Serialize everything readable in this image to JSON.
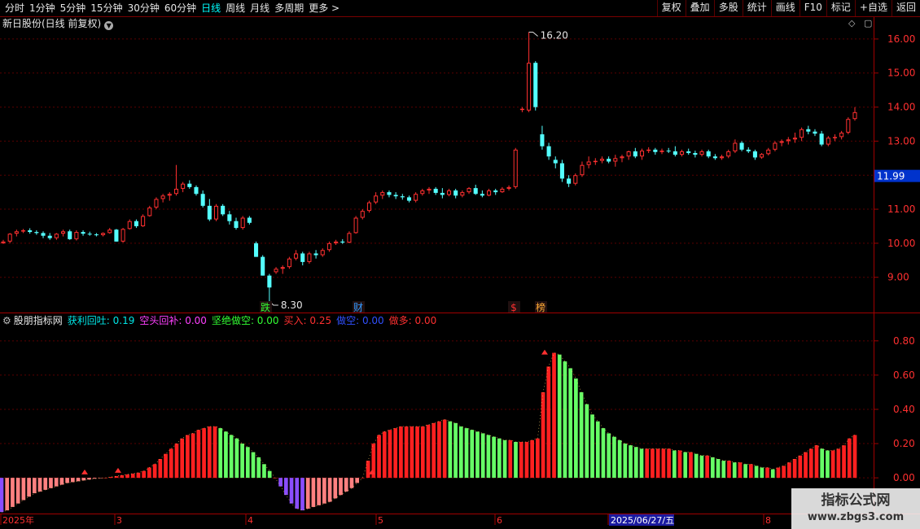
{
  "toolbar": {
    "tabs": [
      "分时",
      "1分钟",
      "5分钟",
      "15分钟",
      "30分钟",
      "60分钟",
      "日线",
      "周线",
      "月线",
      "多周期",
      "更多 >"
    ],
    "active_tab": "日线",
    "tools": [
      "复权",
      "叠加",
      "多股",
      "统计",
      "画线",
      "F10",
      "标记",
      "+自选",
      "返回"
    ]
  },
  "chart_title": "新日股份(日线 前复权)",
  "current_price_label": "11.99",
  "indicator": {
    "name": "股朋指标网",
    "items": [
      {
        "label": "获利回吐: 0.19",
        "color": "#00e5e5"
      },
      {
        "label": "空头回补: 0.00",
        "color": "#ff40ff"
      },
      {
        "label": "坚绝做空: 0.00",
        "color": "#33ff33"
      },
      {
        "label": "买入: 0.25",
        "color": "#ff3030"
      },
      {
        "label": "做空: 0.00",
        "color": "#3050ff"
      },
      {
        "label": "做多: 0.00",
        "color": "#ff3030"
      }
    ]
  },
  "watermark": {
    "line1": "指标公式网",
    "line2": "www.zbgs3.com"
  },
  "chart_data": [
    {
      "type": "candlestick",
      "ylim": [
        8.3,
        16.5
      ],
      "yticks": [
        9.0,
        10.0,
        11.0,
        12.0,
        13.0,
        14.0,
        15.0,
        16.0
      ],
      "high_label": "16.20",
      "low_label": "8.30",
      "markers": [
        "跌",
        "财",
        "$",
        "榜"
      ],
      "candles": [
        [
          10.0,
          10.1,
          9.98,
          10.05
        ],
        [
          10.05,
          10.3,
          10.0,
          10.28
        ],
        [
          10.28,
          10.4,
          10.2,
          10.35
        ],
        [
          10.35,
          10.42,
          10.3,
          10.38
        ],
        [
          10.38,
          10.44,
          10.28,
          10.33
        ],
        [
          10.33,
          10.38,
          10.25,
          10.3
        ],
        [
          10.3,
          10.35,
          10.15,
          10.22
        ],
        [
          10.22,
          10.3,
          10.1,
          10.15
        ],
        [
          10.15,
          10.3,
          10.1,
          10.28
        ],
        [
          10.28,
          10.4,
          10.2,
          10.35
        ],
        [
          10.35,
          10.4,
          10.1,
          10.12
        ],
        [
          10.12,
          10.38,
          10.08,
          10.33
        ],
        [
          10.33,
          10.38,
          10.22,
          10.28
        ],
        [
          10.28,
          10.34,
          10.22,
          10.26
        ],
        [
          10.26,
          10.3,
          10.2,
          10.24
        ],
        [
          10.24,
          10.32,
          10.2,
          10.3
        ],
        [
          10.3,
          10.45,
          10.28,
          10.4
        ],
        [
          10.4,
          10.42,
          10.05,
          10.05
        ],
        [
          10.05,
          10.45,
          10.02,
          10.42
        ],
        [
          10.42,
          10.7,
          10.4,
          10.65
        ],
        [
          10.65,
          10.7,
          10.45,
          10.5
        ],
        [
          10.5,
          10.85,
          10.48,
          10.8
        ],
        [
          10.8,
          11.1,
          10.78,
          11.05
        ],
        [
          11.05,
          11.35,
          11.0,
          11.3
        ],
        [
          11.3,
          11.45,
          11.2,
          11.4
        ],
        [
          11.4,
          11.5,
          11.25,
          11.45
        ],
        [
          11.45,
          12.3,
          11.4,
          11.6
        ],
        [
          11.6,
          11.8,
          11.5,
          11.75
        ],
        [
          11.75,
          11.85,
          11.6,
          11.65
        ],
        [
          11.65,
          11.7,
          11.4,
          11.45
        ],
        [
          11.45,
          11.55,
          11.05,
          11.1
        ],
        [
          11.1,
          11.3,
          10.65,
          10.7
        ],
        [
          10.7,
          11.15,
          10.65,
          11.1
        ],
        [
          11.1,
          11.15,
          10.8,
          10.85
        ],
        [
          10.85,
          10.95,
          10.55,
          10.65
        ],
        [
          10.65,
          10.75,
          10.4,
          10.45
        ],
        [
          10.45,
          10.8,
          10.4,
          10.75
        ],
        [
          10.75,
          10.8,
          10.55,
          10.6
        ],
        [
          10.0,
          10.05,
          9.6,
          9.6
        ],
        [
          9.6,
          9.65,
          9.05,
          9.05
        ],
        [
          9.05,
          9.1,
          8.3,
          8.7
        ],
        [
          9.15,
          9.3,
          9.1,
          9.25
        ],
        [
          9.25,
          9.35,
          9.1,
          9.3
        ],
        [
          9.3,
          9.6,
          9.25,
          9.55
        ],
        [
          9.55,
          9.8,
          9.5,
          9.7
        ],
        [
          9.7,
          9.75,
          9.35,
          9.45
        ],
        [
          9.45,
          9.75,
          9.4,
          9.7
        ],
        [
          9.7,
          9.8,
          9.55,
          9.65
        ],
        [
          9.65,
          9.85,
          9.6,
          9.8
        ],
        [
          9.8,
          10.05,
          9.75,
          10.0
        ],
        [
          10.0,
          10.1,
          9.95,
          10.05
        ],
        [
          10.05,
          10.12,
          9.98,
          10.02
        ],
        [
          10.02,
          10.35,
          10.0,
          10.3
        ],
        [
          10.3,
          10.8,
          10.28,
          10.75
        ],
        [
          10.75,
          11.0,
          10.7,
          10.95
        ],
        [
          10.95,
          11.25,
          10.9,
          11.2
        ],
        [
          11.2,
          11.5,
          11.15,
          11.4
        ],
        [
          11.4,
          11.55,
          11.3,
          11.5
        ],
        [
          11.5,
          11.55,
          11.35,
          11.42
        ],
        [
          11.42,
          11.5,
          11.3,
          11.38
        ],
        [
          11.38,
          11.45,
          11.28,
          11.35
        ],
        [
          11.35,
          11.4,
          11.2,
          11.25
        ],
        [
          11.25,
          11.5,
          11.2,
          11.45
        ],
        [
          11.45,
          11.6,
          11.4,
          11.55
        ],
        [
          11.55,
          11.65,
          11.45,
          11.6
        ],
        [
          11.6,
          11.65,
          11.42,
          11.48
        ],
        [
          11.48,
          11.62,
          11.32,
          11.42
        ],
        [
          11.42,
          11.6,
          11.38,
          11.55
        ],
        [
          11.55,
          11.6,
          11.32,
          11.4
        ],
        [
          11.4,
          11.55,
          11.35,
          11.5
        ],
        [
          11.5,
          11.65,
          11.45,
          11.62
        ],
        [
          11.62,
          11.72,
          11.42,
          11.45
        ],
        [
          11.45,
          11.55,
          11.35,
          11.4
        ],
        [
          11.4,
          11.6,
          11.38,
          11.55
        ],
        [
          11.55,
          11.6,
          11.42,
          11.5
        ],
        [
          11.5,
          11.65,
          11.48,
          11.6
        ],
        [
          11.6,
          11.7,
          11.55,
          11.65
        ],
        [
          11.65,
          12.8,
          11.6,
          12.75
        ],
        [
          13.95,
          14.0,
          13.85,
          13.95
        ],
        [
          13.9,
          16.2,
          13.85,
          15.3
        ],
        [
          15.3,
          15.35,
          13.9,
          14.0
        ],
        [
          13.2,
          13.45,
          12.75,
          12.85
        ],
        [
          12.85,
          12.95,
          12.45,
          12.55
        ],
        [
          12.45,
          12.55,
          12.2,
          12.35
        ],
        [
          12.35,
          12.45,
          11.8,
          11.9
        ],
        [
          11.9,
          12.0,
          11.65,
          11.75
        ],
        [
          11.75,
          12.05,
          11.7,
          12.0
        ],
        [
          12.0,
          12.4,
          11.95,
          12.3
        ],
        [
          12.3,
          12.55,
          12.2,
          12.4
        ],
        [
          12.4,
          12.5,
          12.3,
          12.42
        ],
        [
          12.42,
          12.55,
          12.35,
          12.48
        ],
        [
          12.48,
          12.55,
          12.35,
          12.4
        ],
        [
          12.4,
          12.6,
          12.25,
          12.5
        ],
        [
          12.5,
          12.6,
          12.38,
          12.55
        ],
        [
          12.55,
          12.72,
          12.45,
          12.7
        ],
        [
          12.7,
          12.8,
          12.5,
          12.55
        ],
        [
          12.55,
          12.78,
          12.45,
          12.72
        ],
        [
          12.72,
          12.82,
          12.65,
          12.75
        ],
        [
          12.75,
          12.8,
          12.6,
          12.68
        ],
        [
          12.68,
          12.78,
          12.62,
          12.72
        ],
        [
          12.72,
          12.8,
          12.65,
          12.7
        ],
        [
          12.7,
          12.85,
          12.55,
          12.6
        ],
        [
          12.6,
          12.75,
          12.55,
          12.7
        ],
        [
          12.7,
          12.78,
          12.6,
          12.65
        ],
        [
          12.65,
          12.72,
          12.52,
          12.6
        ],
        [
          12.6,
          12.75,
          12.55,
          12.7
        ],
        [
          12.7,
          12.75,
          12.5,
          12.55
        ],
        [
          12.55,
          12.62,
          12.45,
          12.5
        ],
        [
          12.5,
          12.6,
          12.45,
          12.55
        ],
        [
          12.55,
          12.75,
          12.5,
          12.7
        ],
        [
          12.7,
          13.05,
          12.65,
          12.95
        ],
        [
          12.95,
          13.0,
          12.7,
          12.75
        ],
        [
          12.75,
          12.82,
          12.65,
          12.7
        ],
        [
          12.7,
          12.75,
          12.45,
          12.52
        ],
        [
          12.52,
          12.65,
          12.48,
          12.62
        ],
        [
          12.62,
          12.8,
          12.58,
          12.75
        ],
        [
          12.75,
          13.0,
          12.7,
          12.95
        ],
        [
          12.95,
          13.05,
          12.85,
          13.0
        ],
        [
          13.0,
          13.12,
          12.9,
          13.05
        ],
        [
          13.05,
          13.25,
          12.95,
          13.1
        ],
        [
          13.1,
          13.4,
          13.0,
          13.35
        ],
        [
          13.35,
          13.45,
          13.2,
          13.28
        ],
        [
          13.28,
          13.35,
          13.15,
          13.22
        ],
        [
          13.22,
          13.3,
          12.85,
          12.9
        ],
        [
          12.9,
          13.15,
          12.85,
          13.1
        ],
        [
          13.1,
          13.2,
          13.0,
          13.12
        ],
        [
          13.12,
          13.3,
          13.05,
          13.25
        ],
        [
          13.25,
          13.7,
          13.2,
          13.65
        ],
        [
          13.65,
          14.0,
          13.6,
          13.85
        ]
      ]
    },
    {
      "type": "bar",
      "ylim": [
        -0.18,
        0.88
      ],
      "yticks": [
        0.0,
        0.2,
        0.4,
        0.6,
        0.8
      ],
      "x_labels": [
        "2025年",
        "3",
        "4",
        "5",
        "6",
        "2025/06/27/五",
        "8"
      ],
      "series": [
        {
          "values": [
            -0.2,
            -0.19,
            -0.17,
            -0.15,
            -0.13,
            -0.11,
            -0.09,
            -0.08,
            -0.07,
            -0.06,
            -0.05,
            -0.04,
            -0.03,
            -0.025,
            -0.02,
            -0.015,
            -0.01,
            -0.005,
            -0.002,
            0.0,
            0.005,
            0.01,
            0.015,
            0.02,
            0.025,
            0.03,
            0.04,
            0.06,
            0.08,
            0.11,
            0.14,
            0.17,
            0.2,
            0.23,
            0.25,
            0.26,
            0.28,
            0.29,
            0.3,
            0.3,
            0.29,
            0.27,
            0.25,
            0.23,
            0.2,
            0.18,
            0.15,
            0.12,
            0.08,
            0.04,
            0.0,
            -0.05,
            -0.1,
            -0.15,
            -0.18,
            -0.19,
            -0.18,
            -0.17,
            -0.16,
            -0.15,
            -0.14,
            -0.12,
            -0.1,
            -0.08,
            -0.06,
            -0.03,
            0.0,
            0.1,
            0.2,
            0.25,
            0.27,
            0.28,
            0.29,
            0.3,
            0.3,
            0.3,
            0.3,
            0.3,
            0.31,
            0.32,
            0.33,
            0.34,
            0.33,
            0.32,
            0.3,
            0.29,
            0.28,
            0.27,
            0.26,
            0.25,
            0.24,
            0.23,
            0.22,
            0.22,
            0.21,
            0.21,
            0.21,
            0.22,
            0.23,
            0.5,
            0.65,
            0.73,
            0.72,
            0.68,
            0.64,
            0.58,
            0.5,
            0.43,
            0.37,
            0.33,
            0.29,
            0.26,
            0.24,
            0.22,
            0.2,
            0.19,
            0.18,
            0.17,
            0.17,
            0.17,
            0.17,
            0.17,
            0.17,
            0.16,
            0.16,
            0.15,
            0.15,
            0.14,
            0.13,
            0.13,
            0.12,
            0.11,
            0.1,
            0.1,
            0.09,
            0.09,
            0.08,
            0.08,
            0.07,
            0.06,
            0.06,
            0.05,
            0.06,
            0.07,
            0.09,
            0.11,
            0.13,
            0.15,
            0.17,
            0.19,
            0.17,
            0.16,
            0.16,
            0.17,
            0.19,
            0.23,
            0.25
          ]
        }
      ]
    }
  ]
}
